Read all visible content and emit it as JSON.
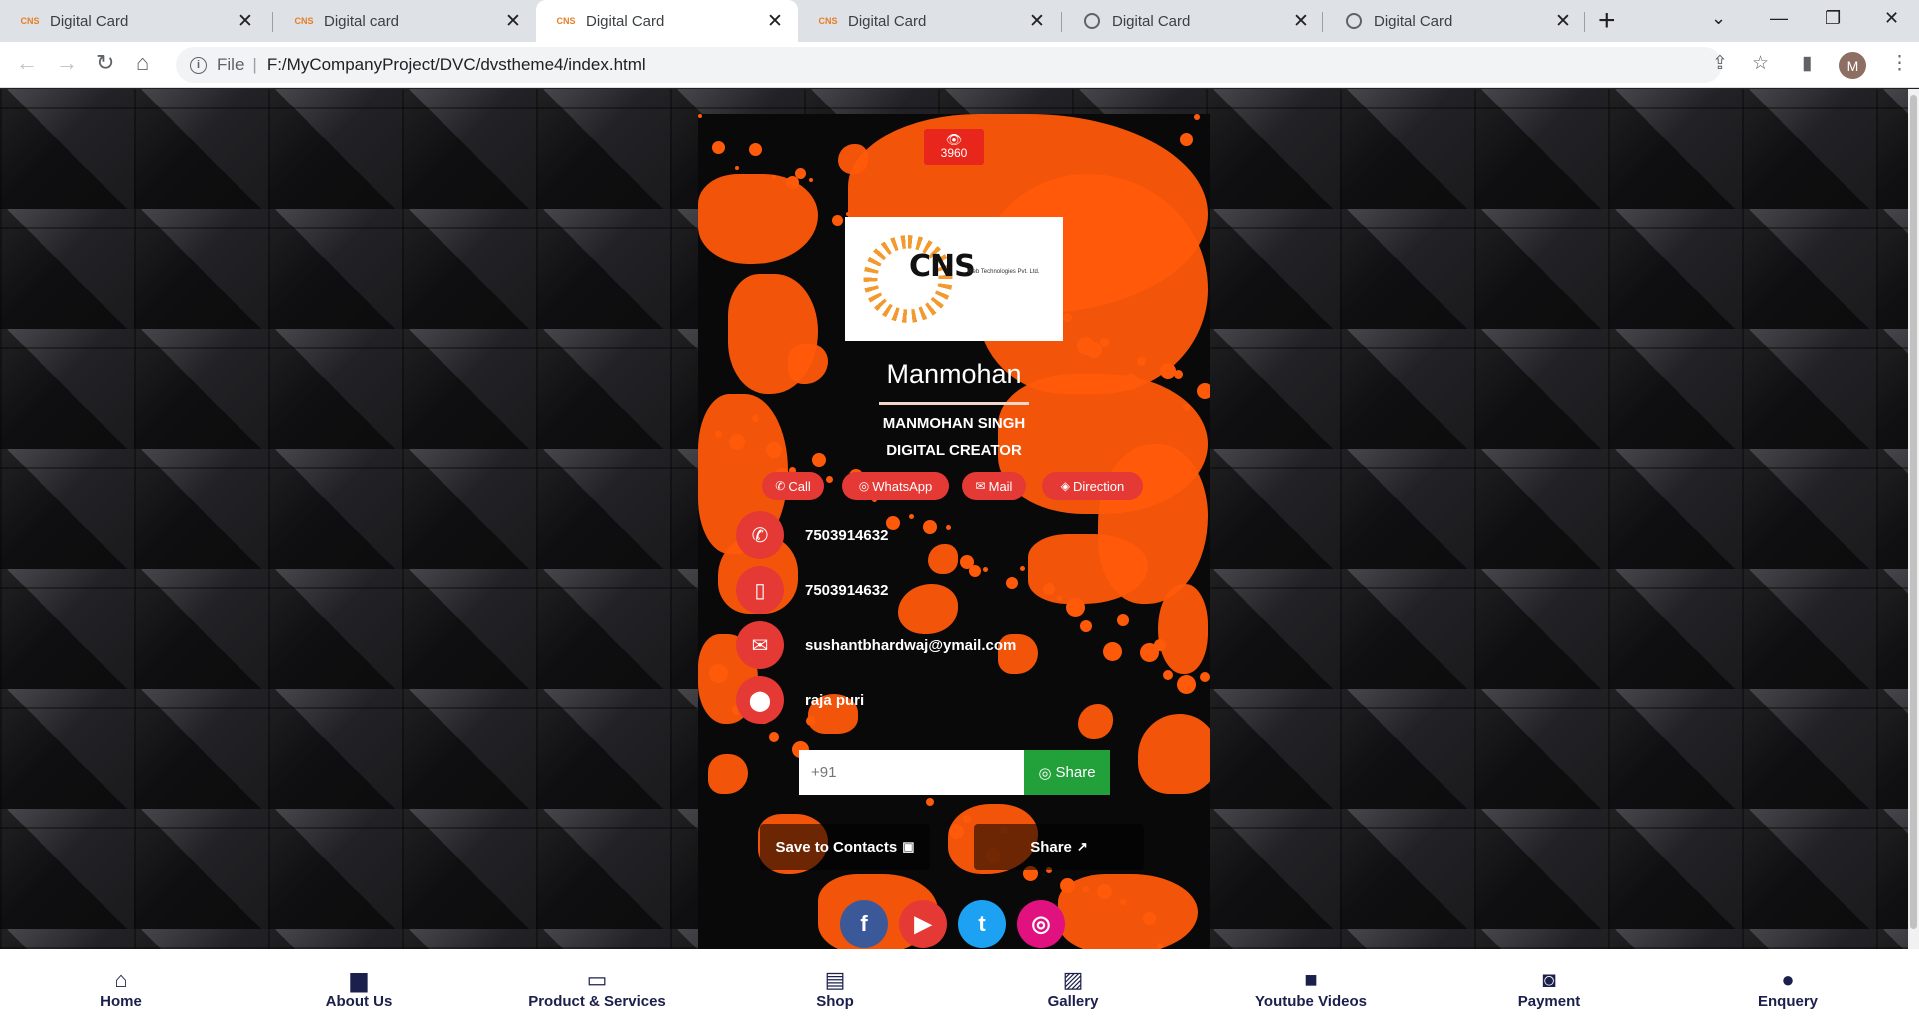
{
  "browser": {
    "tabs": [
      {
        "title": "Digital Card",
        "favicon": "cns-favicon",
        "active": false
      },
      {
        "title": "Digital card",
        "favicon": "cns-favicon",
        "active": false
      },
      {
        "title": "Digital Card",
        "favicon": "cns-favicon",
        "active": true
      },
      {
        "title": "Digital Card",
        "favicon": "cns-favicon",
        "active": false
      },
      {
        "title": "Digital Card",
        "favicon": "globe-icon",
        "active": false
      },
      {
        "title": "Digital Card",
        "favicon": "globe-icon",
        "active": false
      }
    ],
    "address": {
      "scheme_label": "File",
      "path": "F:/MyCompanyProject/DVC/dvstheme4/index.html"
    },
    "profile_initial": "M"
  },
  "card": {
    "view_count": "3960",
    "logo": {
      "text": "CNS",
      "subtext": "Web Technologies Pvt. Ltd."
    },
    "name": "Manmohan",
    "full_name": "MANMOHAN SINGH",
    "designation": "DIGITAL CREATOR",
    "quick_actions": [
      {
        "label": "Call",
        "icon": "phone-icon"
      },
      {
        "label": "WhatsApp",
        "icon": "whatsapp-icon"
      },
      {
        "label": "Mail",
        "icon": "envelope-icon"
      },
      {
        "label": "Direction",
        "icon": "direction-icon"
      }
    ],
    "contacts": [
      {
        "type": "phone",
        "icon": "phone-icon",
        "value": "7503914632"
      },
      {
        "type": "mobile",
        "icon": "mobile-icon",
        "value": "7503914632"
      },
      {
        "type": "email",
        "icon": "envelope-icon",
        "value": "sushantbhardwaj@ymail.com"
      },
      {
        "type": "address",
        "icon": "map-marker-icon",
        "value": "raja puri"
      }
    ],
    "whatsapp_share": {
      "placeholder": "+91",
      "button_label": "Share"
    },
    "save_contacts_label": "Save to Contacts",
    "share_label": "Share",
    "socials": [
      {
        "name": "facebook",
        "icon": "facebook-icon",
        "color": "#3b5998"
      },
      {
        "name": "youtube",
        "icon": "youtube-icon",
        "color": "#e53935"
      },
      {
        "name": "twitter",
        "icon": "twitter-icon",
        "color": "#1da1f2"
      },
      {
        "name": "instagram",
        "icon": "instagram-icon",
        "color": "#e1117f"
      }
    ],
    "accent_color": "#e53935",
    "splash_color": "#ff5a0a"
  },
  "bottom_nav": [
    {
      "label": "Home",
      "icon": "home-icon"
    },
    {
      "label": "About Us",
      "icon": "briefcase-icon"
    },
    {
      "label": "Product & Services",
      "icon": "ticket-icon"
    },
    {
      "label": "Shop",
      "icon": "shop-icon"
    },
    {
      "label": "Gallery",
      "icon": "image-icon"
    },
    {
      "label": "Youtube Videos",
      "icon": "video-icon"
    },
    {
      "label": "Payment",
      "icon": "money-icon"
    },
    {
      "label": "Enquery",
      "icon": "chat-icon"
    }
  ]
}
